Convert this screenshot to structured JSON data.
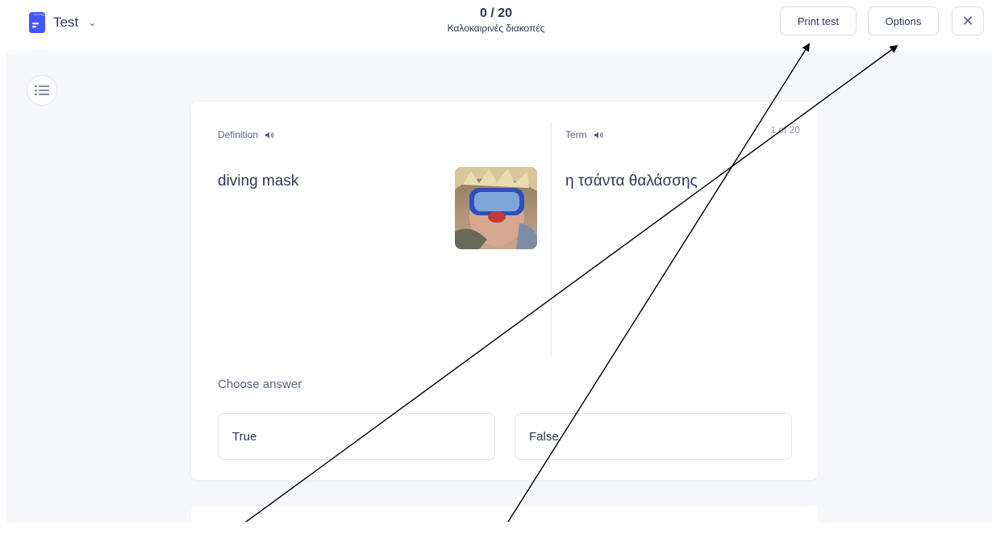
{
  "header": {
    "mode_label": "Test",
    "progress": "0 / 20",
    "set_title": "Καλοκαιρινές διακοπές",
    "print_label": "Print test",
    "options_label": "Options",
    "close_glyph": "✕"
  },
  "question": {
    "definition_label": "Definition",
    "term_label": "Term",
    "counter": "1 of 20",
    "definition_text": "diving mask",
    "term_text": "η τσάντα θαλάσσης",
    "choose_label": "Choose answer",
    "answers": [
      "True",
      "False"
    ]
  },
  "icons": {
    "brand": "study-set-icon",
    "speaker": "speaker-icon",
    "toc": "list-icon",
    "chevron": "chevron-down-icon"
  },
  "colors": {
    "accent": "#4255ff",
    "background": "#f6f7fb",
    "text": "#2e3856"
  }
}
